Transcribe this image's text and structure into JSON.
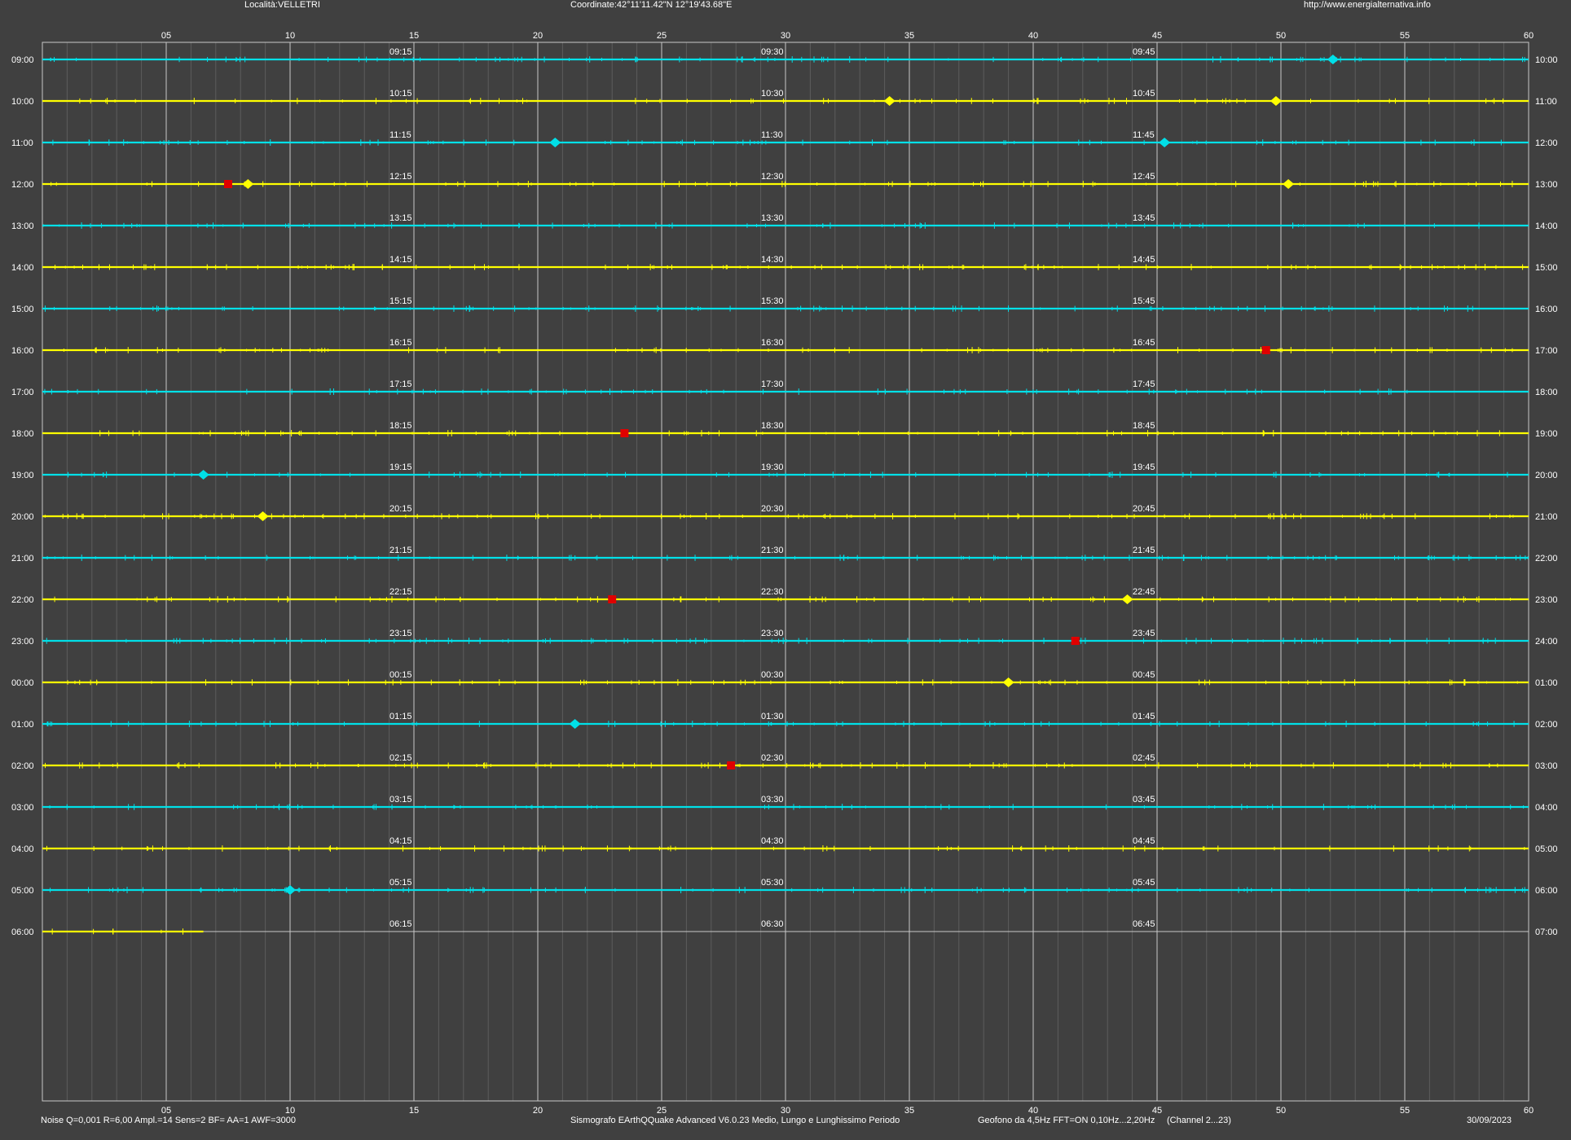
{
  "header": {
    "location": "Località:VELLETRI",
    "coordinates": "Coordinate:42°11'11.42\"N  12°19'43.68\"E",
    "website": "http://www.energialternativa.info"
  },
  "footer": {
    "noise": "Noise Q=0,001 R=6,00 Ampl.=14 Sens=2 BF= AA=1 AWF=3000",
    "software": "Sismografo  EArthQQuake Advanced V6.0.23  Medio, Lungo e Lunghissimo Periodo",
    "geofono": "Geofono da 4,5Hz FFT=ON 0,10Hz...2,20Hz",
    "channel": "(Channel 2...23)",
    "date": "30/09/2023"
  },
  "colors": {
    "background": "#404040",
    "grid_major": "#c8c8c8",
    "grid_minor": "#5c5c5c",
    "trace_cyan": "#00e0e8",
    "trace_yellow": "#ffff00",
    "event_red": "#e00000",
    "text": "#ffffff"
  },
  "chart_data": {
    "type": "line",
    "x_axis": {
      "min": 0,
      "max": 60,
      "unit": "minutes",
      "tick_labels": [
        "05",
        "10",
        "15",
        "20",
        "25",
        "30",
        "35",
        "40",
        "45",
        "50",
        "55",
        "60"
      ],
      "major_grid_every": 5,
      "minor_grid_every": 1
    },
    "left_labels": [
      "09:00",
      "10:00",
      "11:00",
      "12:00",
      "13:00",
      "14:00",
      "15:00",
      "16:00",
      "17:00",
      "18:00",
      "19:00",
      "20:00",
      "21:00",
      "22:00",
      "23:00",
      "00:00",
      "01:00",
      "02:00",
      "03:00",
      "04:00",
      "05:00",
      "06:00"
    ],
    "right_labels": [
      "10:00",
      "11:00",
      "12:00",
      "13:00",
      "14:00",
      "15:00",
      "16:00",
      "17:00",
      "18:00",
      "19:00",
      "20:00",
      "21:00",
      "22:00",
      "23:00",
      "24:00",
      "01:00",
      "02:00",
      "03:00",
      "04:00",
      "05:00",
      "06:00",
      "07:00"
    ],
    "quarter_labels": [
      [
        "09:15",
        "09:30",
        "09:45"
      ],
      [
        "10:15",
        "10:30",
        "10:45"
      ],
      [
        "11:15",
        "11:30",
        "11:45"
      ],
      [
        "12:15",
        "12:30",
        "12:45"
      ],
      [
        "13:15",
        "13:30",
        "13:45"
      ],
      [
        "14:15",
        "14:30",
        "14:45"
      ],
      [
        "15:15",
        "15:30",
        "15:45"
      ],
      [
        "16:15",
        "16:30",
        "16:45"
      ],
      [
        "17:15",
        "17:30",
        "17:45"
      ],
      [
        "18:15",
        "18:30",
        "18:45"
      ],
      [
        "19:15",
        "19:30",
        "19:45"
      ],
      [
        "20:15",
        "20:30",
        "20:45"
      ],
      [
        "21:15",
        "21:30",
        "21:45"
      ],
      [
        "22:15",
        "22:30",
        "22:45"
      ],
      [
        "23:15",
        "23:30",
        "23:45"
      ],
      [
        "00:15",
        "00:30",
        "00:45"
      ],
      [
        "01:15",
        "01:30",
        "01:45"
      ],
      [
        "02:15",
        "02:30",
        "02:45"
      ],
      [
        "03:15",
        "03:30",
        "03:45"
      ],
      [
        "04:15",
        "04:30",
        "04:45"
      ],
      [
        "05:15",
        "05:30",
        "05:45"
      ],
      [
        "06:15",
        "06:30",
        "06:45"
      ]
    ],
    "quarter_minutes": [
      15,
      30,
      45
    ],
    "trace_color_pattern": [
      "cyan",
      "yellow"
    ],
    "last_trace_end_minute": 6.5,
    "events": [
      {
        "row": 0,
        "minute": 52.1,
        "color": "cyan"
      },
      {
        "row": 1,
        "minute": 34.2,
        "color": "yellow"
      },
      {
        "row": 1,
        "minute": 49.8,
        "color": "yellow"
      },
      {
        "row": 2,
        "minute": 20.7,
        "color": "cyan"
      },
      {
        "row": 2,
        "minute": 45.3,
        "color": "cyan"
      },
      {
        "row": 3,
        "minute": 7.5,
        "color": "red"
      },
      {
        "row": 3,
        "minute": 8.3,
        "color": "yellow"
      },
      {
        "row": 3,
        "minute": 50.3,
        "color": "yellow"
      },
      {
        "row": 7,
        "minute": 49.4,
        "color": "red"
      },
      {
        "row": 9,
        "minute": 23.5,
        "color": "red"
      },
      {
        "row": 10,
        "minute": 6.5,
        "color": "cyan"
      },
      {
        "row": 11,
        "minute": 8.9,
        "color": "yellow"
      },
      {
        "row": 13,
        "minute": 23.0,
        "color": "red"
      },
      {
        "row": 13,
        "minute": 43.8,
        "color": "yellow"
      },
      {
        "row": 14,
        "minute": 41.7,
        "color": "red"
      },
      {
        "row": 15,
        "minute": 39.0,
        "color": "yellow"
      },
      {
        "row": 16,
        "minute": 21.5,
        "color": "cyan"
      },
      {
        "row": 17,
        "minute": 27.8,
        "color": "red"
      },
      {
        "row": 20,
        "minute": 10.0,
        "color": "cyan"
      }
    ]
  }
}
